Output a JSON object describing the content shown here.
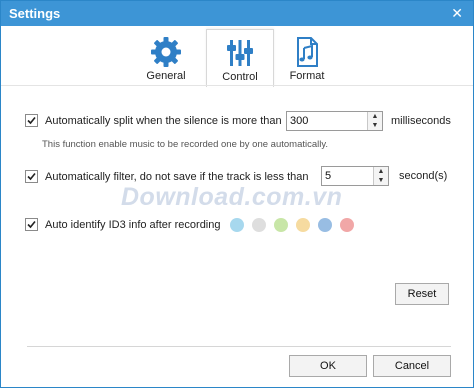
{
  "window": {
    "title": "Settings",
    "close_glyph": "✕"
  },
  "tabs": [
    {
      "label": "General",
      "icon": "gear-icon",
      "active": false
    },
    {
      "label": "Control",
      "icon": "sliders-icon",
      "active": true
    },
    {
      "label": "Format",
      "icon": "music-file-icon",
      "active": false
    }
  ],
  "options": {
    "split": {
      "label": "Automatically split when the silence is more than",
      "checked": true,
      "value": "300",
      "unit": "milliseconds",
      "note": "This function enable music to be recorded one by one automatically."
    },
    "filter": {
      "label": "Automatically filter, do not save if the track is less than",
      "checked": true,
      "value": "5",
      "unit": "second(s)"
    },
    "id3": {
      "label": "Auto identify ID3 info after recording",
      "checked": true
    }
  },
  "dot_colors": [
    "#a7d8ee",
    "#dedede",
    "#c8e6a7",
    "#f6dba0",
    "#98bde3",
    "#f1a7a7"
  ],
  "watermark": "Download.com.vn",
  "buttons": {
    "reset": "Reset",
    "ok": "OK",
    "cancel": "Cancel"
  },
  "colors": {
    "titlebar": "#3d95d6",
    "icon_blue": "#2f7fc6"
  }
}
